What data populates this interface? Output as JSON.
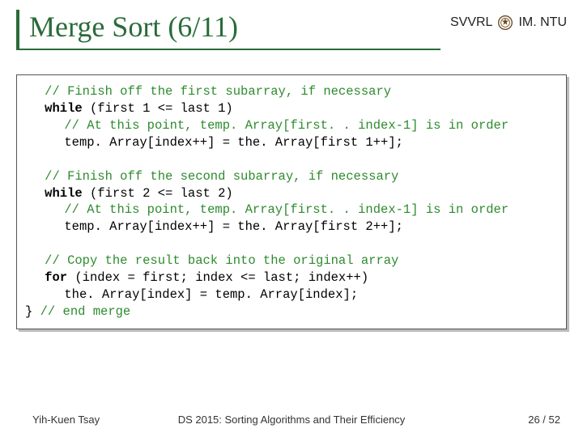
{
  "header": {
    "title": "Merge Sort (6/11)",
    "org_left": "SVVRL",
    "org_right": "IM. NTU"
  },
  "code": {
    "block1": {
      "comment": "// Finish off the first subarray, if necessary",
      "while_kw": "while",
      "while_cond": " (first 1 <= last 1)",
      "inner_comment": "// At this point, temp. Array[first. . index-1] is in order",
      "stmt": "temp. Array[index++] = the. Array[first 1++];"
    },
    "block2": {
      "comment": "// Finish off the second subarray, if necessary",
      "while_kw": "while",
      "while_cond": " (first 2 <= last 2)",
      "inner_comment": "// At this point, temp. Array[first. . index-1] is in order",
      "stmt": "temp. Array[index++] = the. Array[first 2++];"
    },
    "block3": {
      "comment": "// Copy the result back into the original array",
      "for_kw": "for",
      "for_cond": " (index = first; index <= last; index++)",
      "stmt": "the. Array[index] = temp. Array[index];",
      "close_brace": "}",
      "end_comment": " // end merge"
    }
  },
  "footer": {
    "left": "Yih-Kuen Tsay",
    "center": "DS 2015: Sorting Algorithms and Their Efficiency",
    "right": "26 / 52"
  }
}
